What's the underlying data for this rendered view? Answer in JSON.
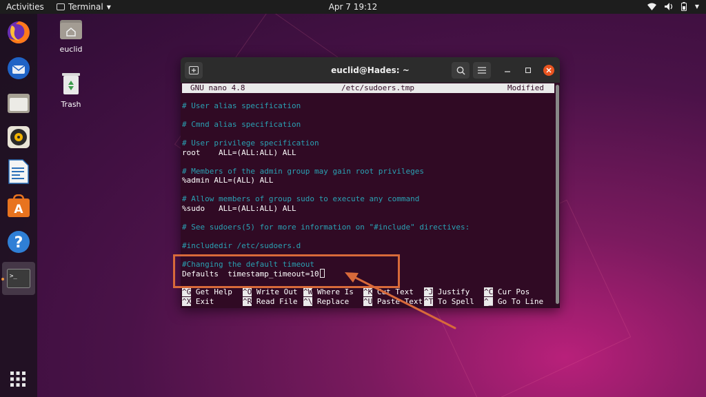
{
  "topbar": {
    "activities": "Activities",
    "app_menu": "Terminal",
    "clock": "Apr 7  19:12"
  },
  "desktop": {
    "home_label": "euclid",
    "trash_label": "Trash"
  },
  "dock": {
    "apps": [
      "firefox",
      "thunderbird",
      "files",
      "rhythmbox",
      "libreoffice-writer",
      "software",
      "help",
      "terminal"
    ]
  },
  "window": {
    "title": "euclid@Hades: ~"
  },
  "nano": {
    "version": "GNU nano 4.8",
    "file": "/etc/sudoers.tmp",
    "state": "Modified",
    "lines": [
      {
        "text": "# User alias specification",
        "comment": true
      },
      {
        "text": "# Cmnd alias specification",
        "comment": true
      },
      {
        "text": "# User privilege specification",
        "comment": true
      },
      {
        "text": "root    ALL=(ALL:ALL) ALL",
        "comment": false
      },
      {
        "text": "# Members of the admin group may gain root privileges",
        "comment": true
      },
      {
        "text": "%admin ALL=(ALL) ALL",
        "comment": false
      },
      {
        "text": "# Allow members of group sudo to execute any command",
        "comment": true
      },
      {
        "text": "%sudo   ALL=(ALL:ALL) ALL",
        "comment": false
      },
      {
        "text": "# See sudoers(5) for more information on \"#include\" directives:",
        "comment": true
      },
      {
        "text": "#includedir /etc/sudoers.d",
        "comment": true
      },
      {
        "text": "#Changing the default timeout",
        "comment": true
      },
      {
        "text": "Defaults  timestamp_timeout=10",
        "comment": false
      }
    ],
    "shortcuts": [
      {
        "key": "^G",
        "label": "Get Help"
      },
      {
        "key": "^X",
        "label": "Exit"
      },
      {
        "key": "^O",
        "label": "Write Out"
      },
      {
        "key": "^R",
        "label": "Read File"
      },
      {
        "key": "^W",
        "label": "Where Is"
      },
      {
        "key": "^\\",
        "label": "Replace"
      },
      {
        "key": "^K",
        "label": "Cut Text"
      },
      {
        "key": "^U",
        "label": "Paste Text"
      },
      {
        "key": "^J",
        "label": "Justify"
      },
      {
        "key": "^T",
        "label": "To Spell"
      },
      {
        "key": "^C",
        "label": "Cur Pos"
      },
      {
        "key": "^_",
        "label": "Go To Line"
      }
    ]
  },
  "colors": {
    "terminal_bg": "#300a24",
    "comment": "#2aa1b3",
    "accent": "#e95420",
    "annotation": "#d86a3a"
  }
}
